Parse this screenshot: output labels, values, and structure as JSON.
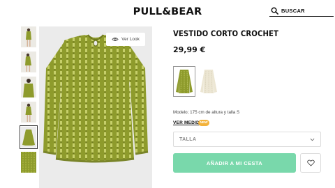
{
  "header": {
    "logo": "PULL&BEAR",
    "search_placeholder": "BUSCAR",
    "search_icon": "search-icon"
  },
  "gallery": {
    "thumbnails": [
      "thumb-look-1",
      "thumb-look-2",
      "thumb-look-3",
      "thumb-look-4",
      "thumb-front",
      "thumb-fabric"
    ],
    "active_thumbnail_index": 4,
    "ver_look_label": "Ver Look",
    "ver_look_icon": "eye-icon"
  },
  "product": {
    "title": "VESTIDO CORTO CROCHET",
    "price": "29,99 €",
    "colors": [
      "olive green",
      "ecru"
    ],
    "selected_color_index": 0,
    "model_info": "Modelo; 175 cm de altura y talla S",
    "size_guide_label": "VER MEDIDAS",
    "size_guide_badge": "NEW",
    "size_select_label": "TALLA",
    "add_to_cart_label": "AÑADIR A MI CESTA",
    "favorite_icon": "heart-icon"
  },
  "colors": {
    "accent": "#79d8ab",
    "badge": "#f3b23a",
    "dress": "#8e9b2c",
    "image_bg": "#ebebeb"
  }
}
